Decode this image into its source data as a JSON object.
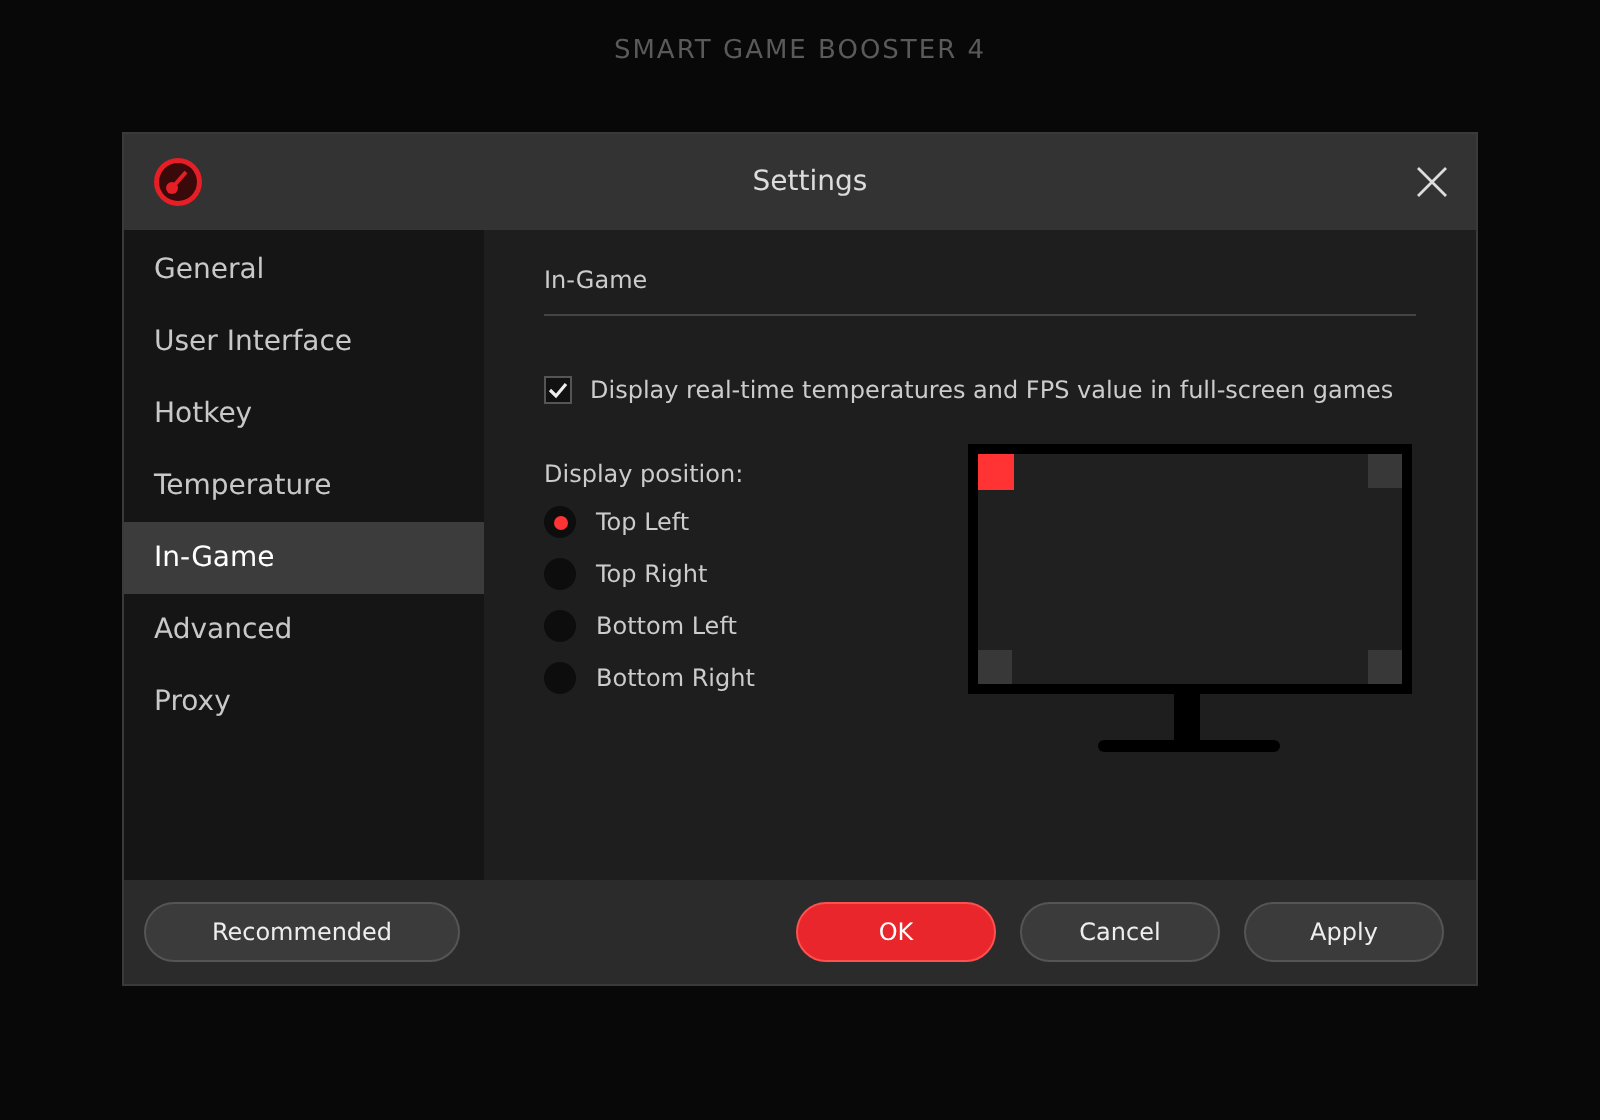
{
  "app": {
    "title": "SMART GAME BOOSTER 4"
  },
  "dialog": {
    "title": "Settings"
  },
  "sidebar": {
    "items": [
      {
        "label": "General",
        "selected": false
      },
      {
        "label": "User Interface",
        "selected": false
      },
      {
        "label": "Hotkey",
        "selected": false
      },
      {
        "label": "Temperature",
        "selected": false
      },
      {
        "label": "In-Game",
        "selected": true
      },
      {
        "label": "Advanced",
        "selected": false
      },
      {
        "label": "Proxy",
        "selected": false
      }
    ]
  },
  "content": {
    "heading": "In-Game",
    "overlay_option": {
      "label": "Display real-time temperatures and FPS value in full-screen games",
      "checked": true
    },
    "position_label": "Display position:",
    "positions": [
      {
        "label": "Top Left",
        "selected": true
      },
      {
        "label": "Top Right",
        "selected": false
      },
      {
        "label": "Bottom Left",
        "selected": false
      },
      {
        "label": "Bottom Right",
        "selected": false
      }
    ]
  },
  "buttons": [
    {
      "label": "Recommended",
      "kind": "secondary"
    },
    {
      "label": "OK",
      "kind": "primary"
    },
    {
      "label": "Cancel",
      "kind": "secondary"
    },
    {
      "label": "Apply",
      "kind": "secondary"
    }
  ]
}
